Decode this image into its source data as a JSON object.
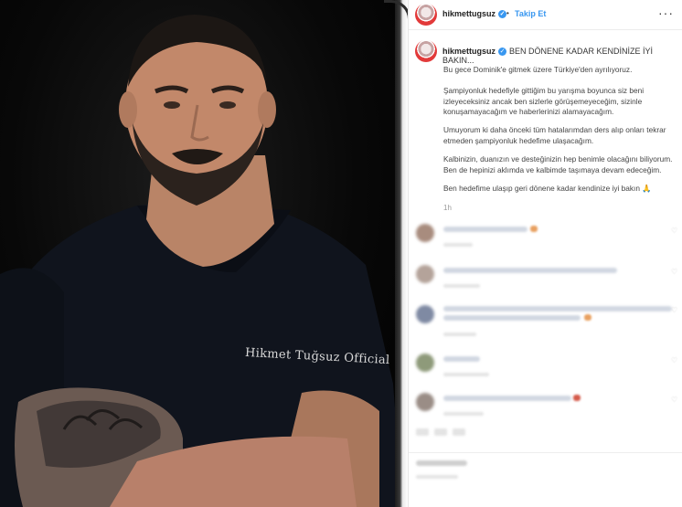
{
  "profile": {
    "username": "hikmettugsuz",
    "follow_label": "Takip Et",
    "separator": "•",
    "more_label": "···"
  },
  "photo": {
    "shirt_text": "Hikmet Tuğsuz Official"
  },
  "post": {
    "title": "BEN DÖNENE KADAR KENDİNİZE İYİ BAKIN...",
    "paragraphs": [
      "Bu gece Dominik'e gitmek üzere Türkiye'den ayrılıyoruz.",
      "Şampiyonluk hedefiyle gittiğim bu yarışma boyunca siz beni izleyeceksiniz ancak ben sizlerle görüşemeyeceğim, sizinle konuşamayacağım ve haberlerinizi alamayacağım.",
      "Umuyorum ki daha önceki tüm hatalarımdan ders alıp onları tekrar etmeden şampiyonluk hedefime ulaşacağım.",
      "Kalbinizin, duanızın ve desteğinizin hep benimle olacağını biliyorum. Ben de hepinizi aklımda ve kalbimde taşımaya devam edeceğim.",
      "Ben hedefime ulaşıp geri dönene kadar kendinize iyi bakın 🙏"
    ],
    "time": "1h"
  },
  "colors": {
    "accent": "#3897f0",
    "text": "#222222",
    "muted": "#9a9a9a"
  },
  "icons": {
    "verified": "verified-badge-icon",
    "heart": "heart-icon",
    "more": "more-options-icon"
  }
}
